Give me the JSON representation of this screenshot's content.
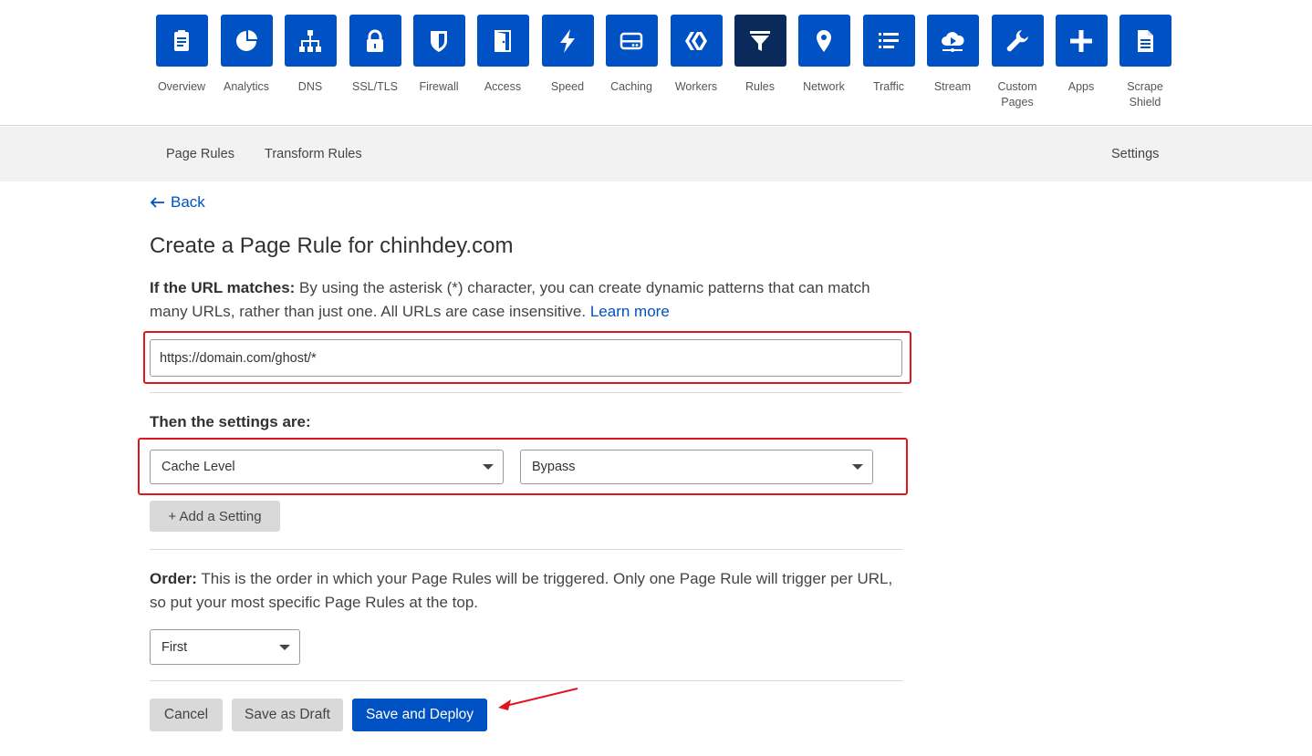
{
  "nav": {
    "items": [
      {
        "label": "Overview",
        "icon": "clipboard-icon"
      },
      {
        "label": "Analytics",
        "icon": "pie-chart-icon"
      },
      {
        "label": "DNS",
        "icon": "network-tree-icon"
      },
      {
        "label": "SSL/TLS",
        "icon": "lock-icon"
      },
      {
        "label": "Firewall",
        "icon": "shield-icon"
      },
      {
        "label": "Access",
        "icon": "door-icon"
      },
      {
        "label": "Speed",
        "icon": "lightning-icon"
      },
      {
        "label": "Caching",
        "icon": "server-drive-icon"
      },
      {
        "label": "Workers",
        "icon": "workers-icon"
      },
      {
        "label": "Rules",
        "icon": "filter-icon"
      },
      {
        "label": "Network",
        "icon": "location-pin-icon"
      },
      {
        "label": "Traffic",
        "icon": "list-icon"
      },
      {
        "label": "Stream",
        "icon": "cloud-play-icon"
      },
      {
        "label": "Custom Pages",
        "icon": "wrench-icon"
      },
      {
        "label": "Apps",
        "icon": "plus-icon"
      },
      {
        "label": "Scrape Shield",
        "icon": "document-icon"
      }
    ],
    "active": "Rules"
  },
  "subnav": {
    "page_rules": "Page Rules",
    "transform_rules": "Transform Rules",
    "settings": "Settings"
  },
  "back_label": "Back",
  "title": "Create a Page Rule for chinhdey.com",
  "url_section": {
    "label": "If the URL matches:",
    "description": " By using the asterisk (*) character, you can create dynamic patterns that can match many URLs, rather than just one. All URLs are case insensitive. ",
    "learn_more": "Learn more",
    "url_value": "https://domain.com/ghost/*"
  },
  "settings_section": {
    "heading": "Then the settings are:",
    "setting_select": "Cache Level",
    "value_select": "Bypass",
    "add_setting": "+ Add a Setting"
  },
  "order_section": {
    "label": "Order:",
    "description": " This is the order in which your Page Rules will be triggered. Only one Page Rule will trigger per URL, so put your most specific Page Rules at the top.",
    "order_value": "First"
  },
  "buttons": {
    "cancel": "Cancel",
    "save_draft": "Save as Draft",
    "save_deploy": "Save and Deploy"
  },
  "colors": {
    "brand_blue": "#0051c3",
    "active_nav": "#0b2a5c",
    "annotation_red": "#e0161e"
  }
}
